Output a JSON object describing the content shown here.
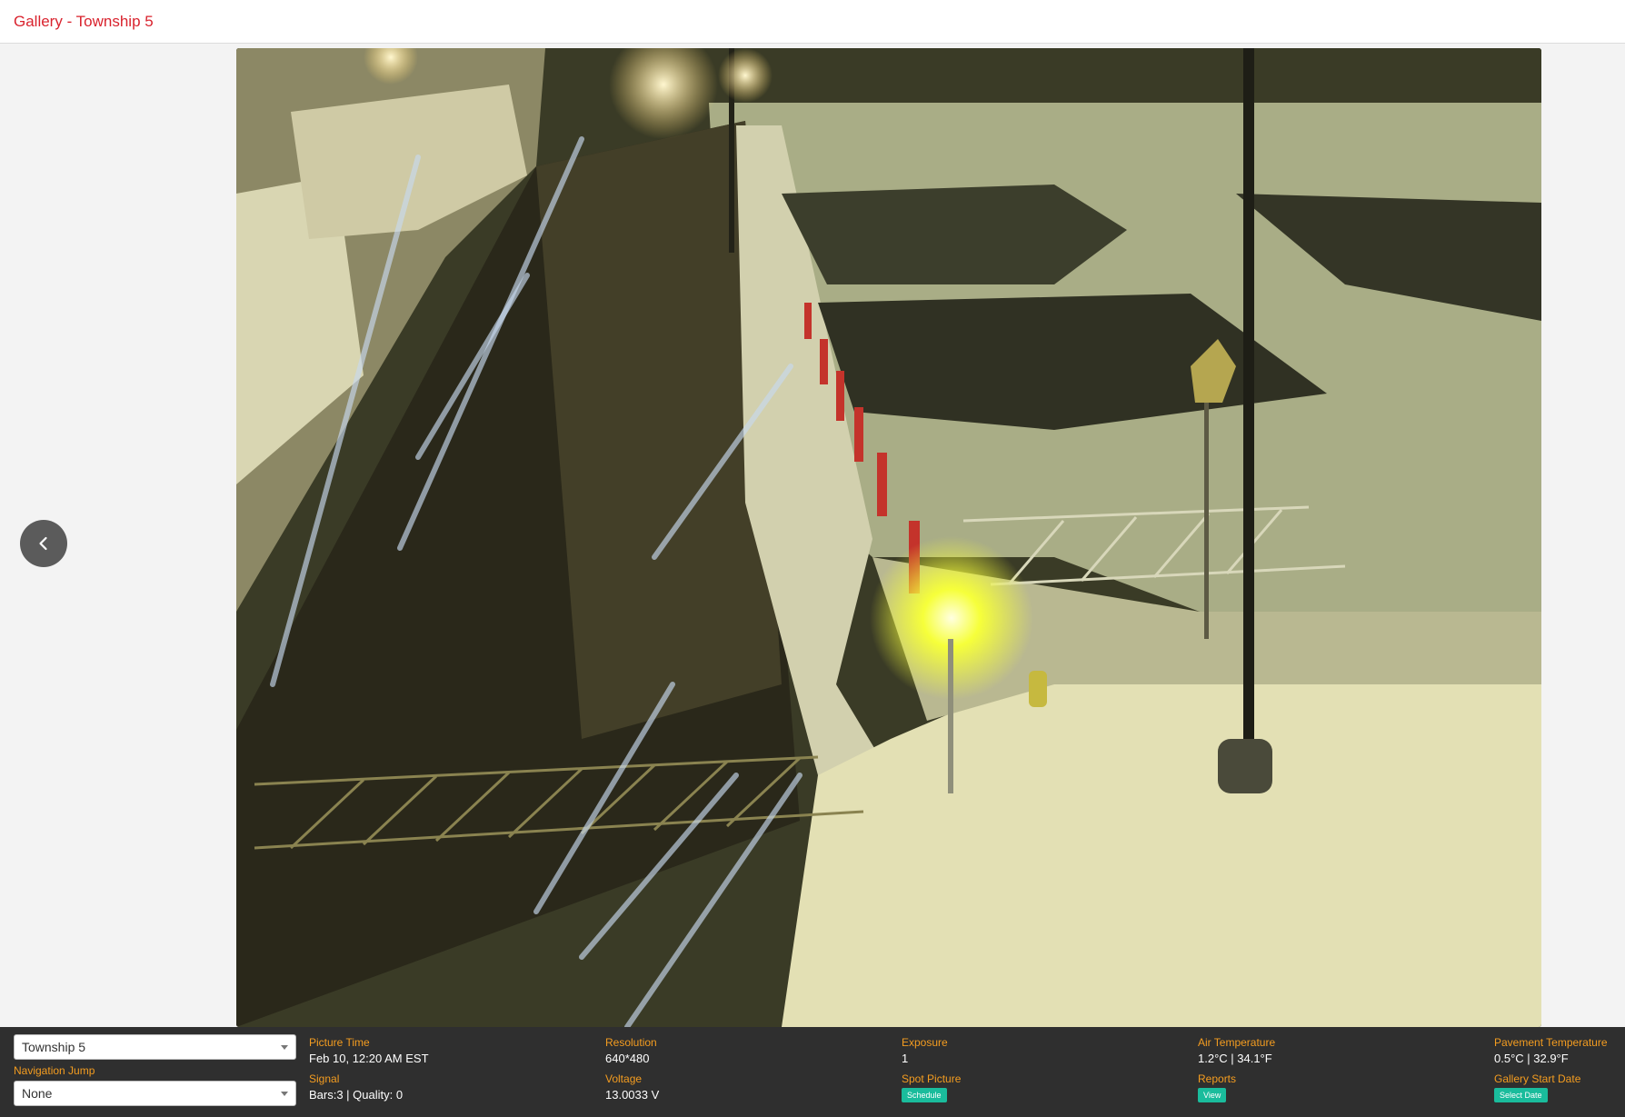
{
  "header": {
    "title": "Gallery - Township 5"
  },
  "nav": {
    "prev_icon": "chevron-left-icon"
  },
  "footer": {
    "location_select": {
      "value": "Township 5"
    },
    "navigation_jump": {
      "label": "Navigation Jump",
      "value": "None"
    },
    "picture_time": {
      "label": "Picture Time",
      "value": "Feb 10, 12:20 AM EST"
    },
    "signal": {
      "label": "Signal",
      "value": "Bars:3 | Quality: 0"
    },
    "resolution": {
      "label": "Resolution",
      "value": "640*480"
    },
    "voltage": {
      "label": "Voltage",
      "value": "13.0033 V"
    },
    "exposure": {
      "label": "Exposure",
      "value": "1"
    },
    "spot_picture": {
      "label": "Spot Picture",
      "button": "Schedule"
    },
    "air_temperature": {
      "label": "Air Temperature",
      "value": "1.2°C | 34.1°F"
    },
    "reports": {
      "label": "Reports",
      "button": "View"
    },
    "pavement_temperature": {
      "label": "Pavement Temperature",
      "value": "0.5°C | 32.9°F"
    },
    "gallery_start_date": {
      "label": "Gallery Start Date",
      "button": "Select Date"
    }
  },
  "colors": {
    "accent": "#d9232e",
    "label": "#f39c20",
    "button": "#1abc9c",
    "footer_bg": "#2f2f2f"
  }
}
